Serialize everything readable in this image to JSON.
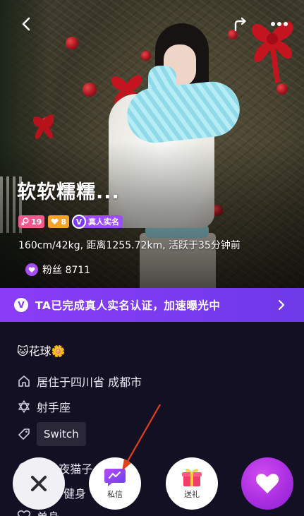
{
  "profile": {
    "name": "软软糯糯...",
    "badges": {
      "age_badge": "19",
      "level_badge": "8",
      "verified_badge": "真人实名"
    },
    "stats_line": "160cm/42kg, 距离1255.72km, 活跃于35分钟前",
    "fans_label": "粉丝 8711"
  },
  "verify_banner": {
    "badge": "V",
    "text": "TA已完成真人实名认证，加速曝光中"
  },
  "details": {
    "nickname": "🐱花球🌼",
    "location": "居住于四川省 成都市",
    "zodiac": "射手座",
    "interest_chip": "Switch",
    "partial_row_1": "...、夜猫子...戏",
    "partial_row_2": "健身",
    "partial_row_3": "单身"
  },
  "actions": {
    "message_label": "私信",
    "gift_label": "送礼"
  },
  "colors": {
    "banner": "#7c3bf0",
    "like_button": "#a72de0",
    "background": "#141024",
    "annotation_arrow": "#e0401e"
  }
}
